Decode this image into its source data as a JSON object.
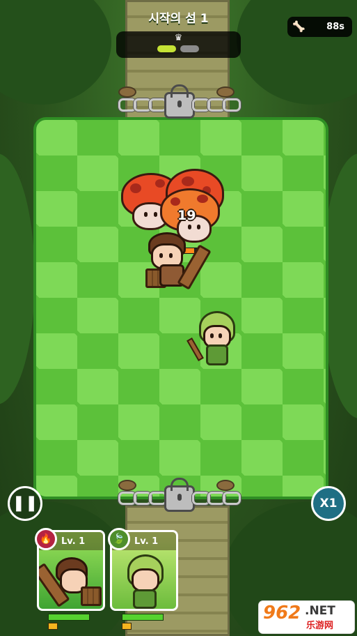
{
  "header": {
    "stage_title": "시작의 섬 1",
    "crown_icon": "crown-icon",
    "wave_progress": {
      "total_waves": 2,
      "current_wave": 1
    },
    "timer_value": "88s",
    "timer_icon": "bone-icon"
  },
  "battle": {
    "damage_number": "19",
    "enemy_hp_fraction": 0.7,
    "enemies": [
      "mushroom",
      "mushroom",
      "mushroom"
    ]
  },
  "controls": {
    "pause_icon": "pause-icon",
    "speed_label": "X1"
  },
  "heroes": [
    {
      "level_label": "Lv. 1",
      "element_icon": "fire-icon",
      "element_glyph": "🔥",
      "hp_fraction": 1.0,
      "xp_fraction": 0.2
    },
    {
      "level_label": "Lv. 1",
      "element_icon": "leaf-icon",
      "element_glyph": "🍃",
      "hp_fraction": 1.0,
      "xp_fraction": 0.2
    }
  ],
  "watermark": {
    "number": "962",
    "suffix": ".NET",
    "subtitle": "乐游网"
  },
  "colors": {
    "board_light": "#7ed957",
    "board_dark": "#5cc13a",
    "speed_button": "#1f6f84",
    "progress_active": "#c5e335"
  }
}
